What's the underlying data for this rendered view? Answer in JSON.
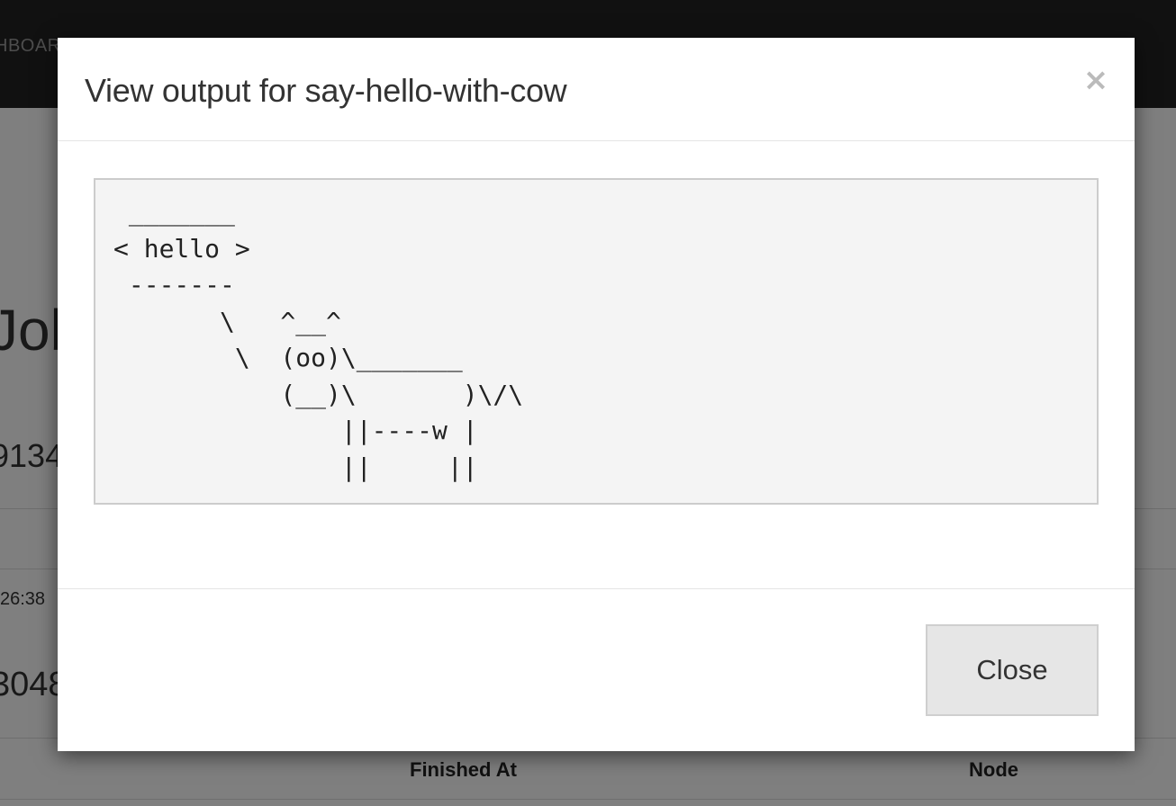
{
  "background": {
    "topbar_nav": "HBOARD",
    "page_title": "Job",
    "id_fragment": "9134",
    "time_fragment": "26:38",
    "number_fragment": "3048",
    "table_headers": {
      "finished_at": "Finished At",
      "node": "Node"
    }
  },
  "modal": {
    "title": "View output for say-hello-with-cow",
    "close_icon": "×",
    "output": " _______\n< hello >\n -------\n       \\   ^__^\n        \\  (oo)\\_______\n           (__)\\       )\\/\\\n               ||----w |\n               ||     ||",
    "close_button_label": "Close"
  },
  "icons": {
    "close": "close-icon"
  },
  "colors": {
    "topbar": "#222222",
    "backdrop": "rgba(0,0,0,0.5)",
    "output_bg": "#f4f4f4",
    "button_bg": "#e6e6e6"
  }
}
